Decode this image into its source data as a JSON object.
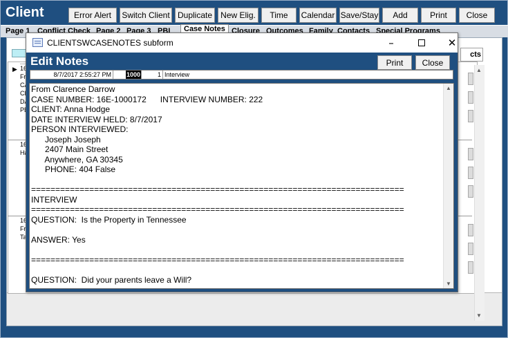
{
  "form": {
    "title": "Client"
  },
  "toolbar": {
    "buttons": [
      {
        "label": "Error Alert"
      },
      {
        "label": "Switch Client"
      },
      {
        "label": "Duplicate"
      },
      {
        "label": "New Elig."
      },
      {
        "label": "Time"
      },
      {
        "label": "Calendar"
      },
      {
        "label": "Save/Stay"
      },
      {
        "label": "Add"
      },
      {
        "label": "Print"
      },
      {
        "label": "Close"
      }
    ]
  },
  "tabs": [
    {
      "label": "Page 1"
    },
    {
      "label": "Conflict Check"
    },
    {
      "label": "Page 2"
    },
    {
      "label": "Page 3"
    },
    {
      "label": "PBI"
    },
    {
      "label": "Case Notes"
    },
    {
      "label": "Closure"
    },
    {
      "label": "Outcomes"
    },
    {
      "label": "Family"
    },
    {
      "label": "Contacts"
    },
    {
      "label": "Special Programs"
    }
  ],
  "background": {
    "partial_tab_label": "cts",
    "records": [
      {
        "lines": [
          "16",
          "Fr",
          "CA",
          "CL",
          "DA",
          "PE"
        ]
      },
      {
        "lines": [
          "16",
          "Ha"
        ]
      },
      {
        "lines": [
          "16",
          "Fr",
          "Ta"
        ]
      }
    ]
  },
  "subform": {
    "window_title": "CLIENTSWCASENOTES subform",
    "heading": "Edit Notes",
    "print_label": "Print",
    "close_label": "Close",
    "record": {
      "datetime": "8/7/2017 2:55:27 PM",
      "id": "1000",
      "count": "1",
      "type": "Interview"
    },
    "notes_lines": [
      "From Clarence Darrow",
      "CASE NUMBER: 16E-1000172      INTERVIEW NUMBER: 222",
      "CLIENT: Anna Hodge",
      "DATE INTERVIEW HELD: 8/7/2017",
      "PERSON INTERVIEWED:",
      "      Joseph Joseph",
      "      2407 Main Street",
      "      Anywhere, GA 30345",
      "      PHONE: 404 False",
      "",
      "=============================================================================",
      "INTERVIEW",
      "=============================================================================",
      "QUESTION:  Is the Property in Tennessee",
      "",
      "ANSWER: Yes",
      "",
      "=============================================================================",
      "",
      "QUESTION:  Did your parents leave a Will?"
    ]
  }
}
